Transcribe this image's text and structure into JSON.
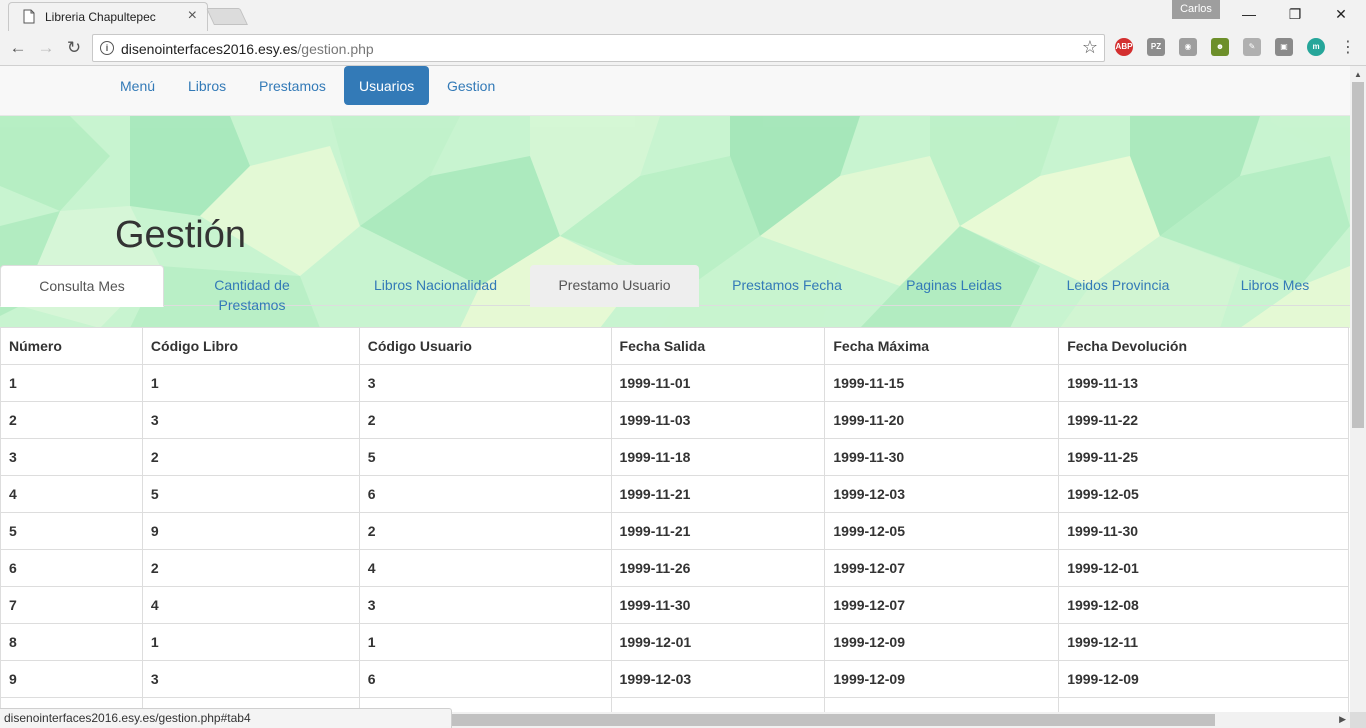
{
  "browser": {
    "tab_title": "Libreria Chapultepec",
    "profile_name": "Carlos",
    "url_host": "disenointerfaces2016.esy.es",
    "url_path": "/gestion.php",
    "status_url": "disenointerfaces2016.esy.es/gestion.php#tab4",
    "extensions": [
      "adblock-plus-icon",
      "pz-icon",
      "camera-icon",
      "character-icon",
      "pen-icon",
      "evernote-icon",
      "m-icon"
    ]
  },
  "navbar": {
    "items": [
      "Menú",
      "Libros",
      "Prestamos",
      "Usuarios",
      "Gestion"
    ],
    "active": "Usuarios"
  },
  "page": {
    "title": "Gestión"
  },
  "tabs": {
    "items": [
      "Consulta Mes",
      "Cantidad de Prestamos",
      "Libros Nacionalidad",
      "Prestamo Usuario",
      "Prestamos Fecha",
      "Paginas Leidas",
      "Leidos Provincia",
      "Libros Mes"
    ],
    "active": "Consulta Mes",
    "hovered": "Prestamo Usuario"
  },
  "table": {
    "headers": [
      "Número",
      "Código Libro",
      "Código Usuario",
      "Fecha Salida",
      "Fecha Máxima",
      "Fecha Devolución"
    ],
    "rows": [
      [
        "1",
        "1",
        "3",
        "1999-11-01",
        "1999-11-15",
        "1999-11-13"
      ],
      [
        "2",
        "3",
        "2",
        "1999-11-03",
        "1999-11-20",
        "1999-11-22"
      ],
      [
        "3",
        "2",
        "5",
        "1999-11-18",
        "1999-11-30",
        "1999-11-25"
      ],
      [
        "4",
        "5",
        "6",
        "1999-11-21",
        "1999-12-03",
        "1999-12-05"
      ],
      [
        "5",
        "9",
        "2",
        "1999-11-21",
        "1999-12-05",
        "1999-11-30"
      ],
      [
        "6",
        "2",
        "4",
        "1999-11-26",
        "1999-12-07",
        "1999-12-01"
      ],
      [
        "7",
        "4",
        "3",
        "1999-11-30",
        "1999-12-07",
        "1999-12-08"
      ],
      [
        "8",
        "1",
        "1",
        "1999-12-01",
        "1999-12-09",
        "1999-12-11"
      ],
      [
        "9",
        "3",
        "6",
        "1999-12-03",
        "1999-12-09",
        "1999-12-09"
      ],
      [
        "",
        "",
        "",
        "",
        "",
        ""
      ]
    ]
  },
  "colors": {
    "primary": "#337ab7",
    "hero_green": "#c6f3cf"
  }
}
